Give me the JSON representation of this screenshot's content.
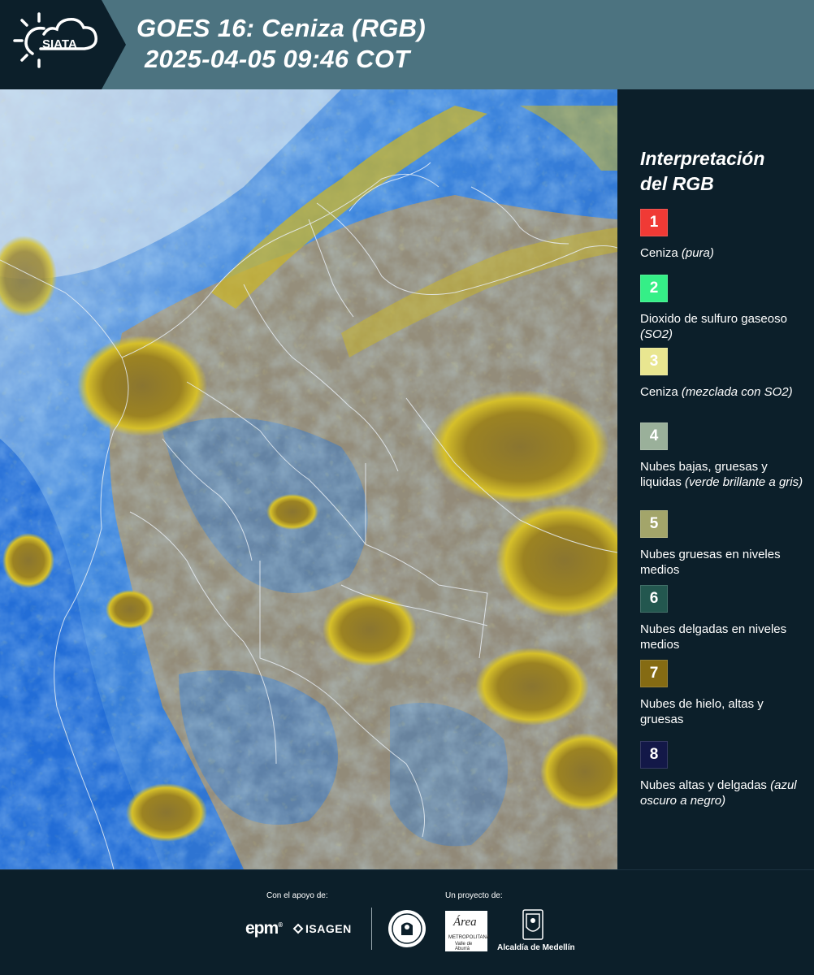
{
  "header": {
    "brand": "SIATA",
    "title_line1": "GOES 16: Ceniza (RGB)",
    "title_line2": "2025-04-05 09:46 COT"
  },
  "legend": {
    "title_line1": "Interpretación",
    "title_line2": "del RGB",
    "items": [
      {
        "number": "1",
        "color": "#f03a35",
        "text": "Ceniza",
        "note": "(pura)"
      },
      {
        "number": "2",
        "color": "#35ef87",
        "text": "Dioxido de sulfuro gaseoso",
        "note": "(SO2)"
      },
      {
        "number": "3",
        "color": "#e9e690",
        "text": "Ceniza",
        "note": "(mezclada con SO2)"
      },
      {
        "number": "4",
        "color": "#9ab09a",
        "text": "Nubes bajas, gruesas y liquidas",
        "note": "(verde brillante a gris)"
      },
      {
        "number": "5",
        "color": "#a3a56a",
        "text": "Nubes gruesas en niveles medios",
        "note": ""
      },
      {
        "number": "6",
        "color": "#23574f",
        "text": "Nubes delgadas en niveles medios",
        "note": ""
      },
      {
        "number": "7",
        "color": "#856b13",
        "text": "Nubes de hielo, altas y gruesas",
        "note": ""
      },
      {
        "number": "8",
        "color": "#131848",
        "text": "Nubes altas y delgadas",
        "note": "(azul oscuro a negro)"
      }
    ]
  },
  "footer": {
    "support_label": "Con el apoyo de:",
    "project_label": "Un proyecto de:",
    "sponsor1": "epm",
    "sponsor1_mark": "®",
    "sponsor2": "ISAGEN",
    "partner1_top": "Área",
    "partner1_line1": "METROPOLITANA",
    "partner1_line2": "Valle de Aburrá",
    "partner2": "Alcaldía de Medellín"
  },
  "colors": {
    "header_bg": "#4c7380",
    "logo_bg": "#0c1f2a",
    "panel_bg": "#0c1f2a",
    "ocean_blue": "#1f6ad6",
    "land_tan": "#a48f6a",
    "cloud_yellow": "#a68a1a"
  }
}
